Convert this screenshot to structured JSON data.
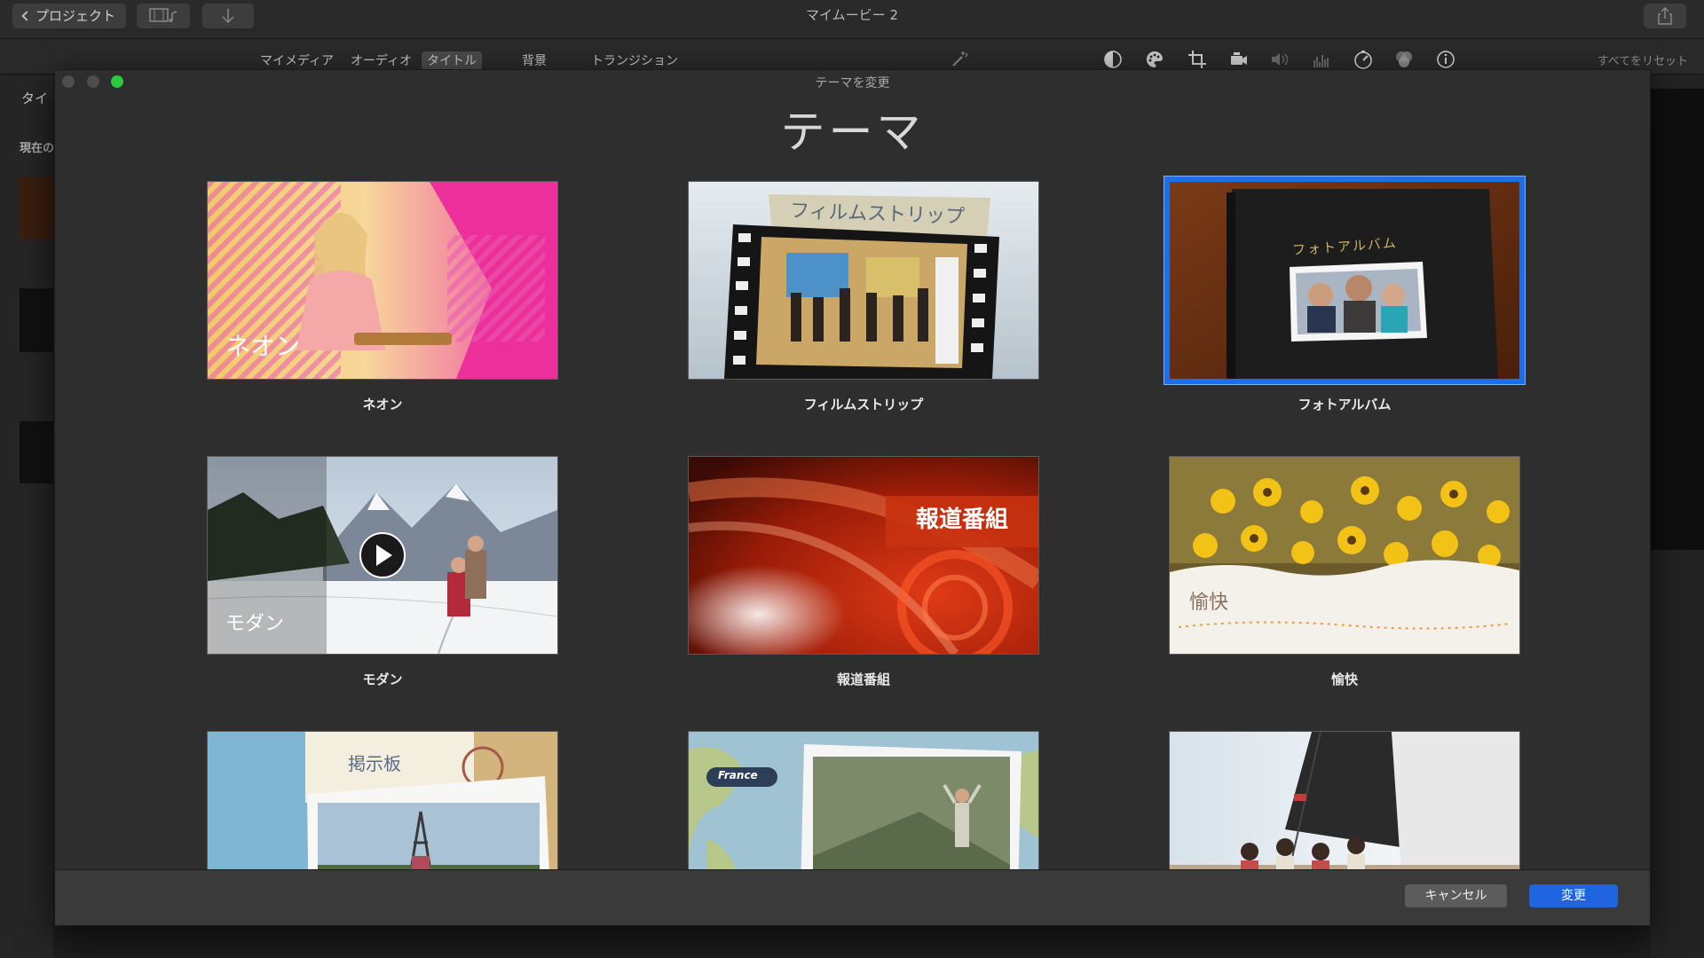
{
  "app": {
    "title": "マイムービー 2",
    "back_label": "プロジェクト",
    "tabs": [
      {
        "label": "マイメディア",
        "active": false
      },
      {
        "label": "オーディオ",
        "active": false
      },
      {
        "label": "タイトル",
        "active": true
      },
      {
        "label": "背景",
        "active": false
      },
      {
        "label": "トランジション",
        "active": false
      }
    ],
    "reset_all": "すべてをリセット",
    "left_tab": "タイ",
    "left_current": "現在の"
  },
  "dialog": {
    "window_title": "テーマを変更",
    "heading": "テーマ",
    "themes": [
      {
        "label": "ネオン",
        "thumb_text": "ネオン",
        "selected": false
      },
      {
        "label": "フィルムストリップ",
        "thumb_text": "フィルムストリップ",
        "selected": false
      },
      {
        "label": "フォトアルバム",
        "thumb_text": "フォトアルバム",
        "selected": true
      },
      {
        "label": "モダン",
        "thumb_text": "モダン",
        "selected": false
      },
      {
        "label": "報道番組",
        "thumb_text": "報道番組",
        "selected": false
      },
      {
        "label": "愉快",
        "thumb_text": "愉快",
        "selected": false
      },
      {
        "label": "",
        "thumb_text": "掲示板",
        "selected": false
      },
      {
        "label": "",
        "thumb_text": "France",
        "selected": false
      },
      {
        "label": "",
        "thumb_text": "",
        "selected": false
      }
    ],
    "cancel_label": "キャンセル",
    "change_label": "変更"
  },
  "colors": {
    "accent": "#1f64e0",
    "selection": "#1c6fe6",
    "zoom_button": "#2cc840"
  }
}
